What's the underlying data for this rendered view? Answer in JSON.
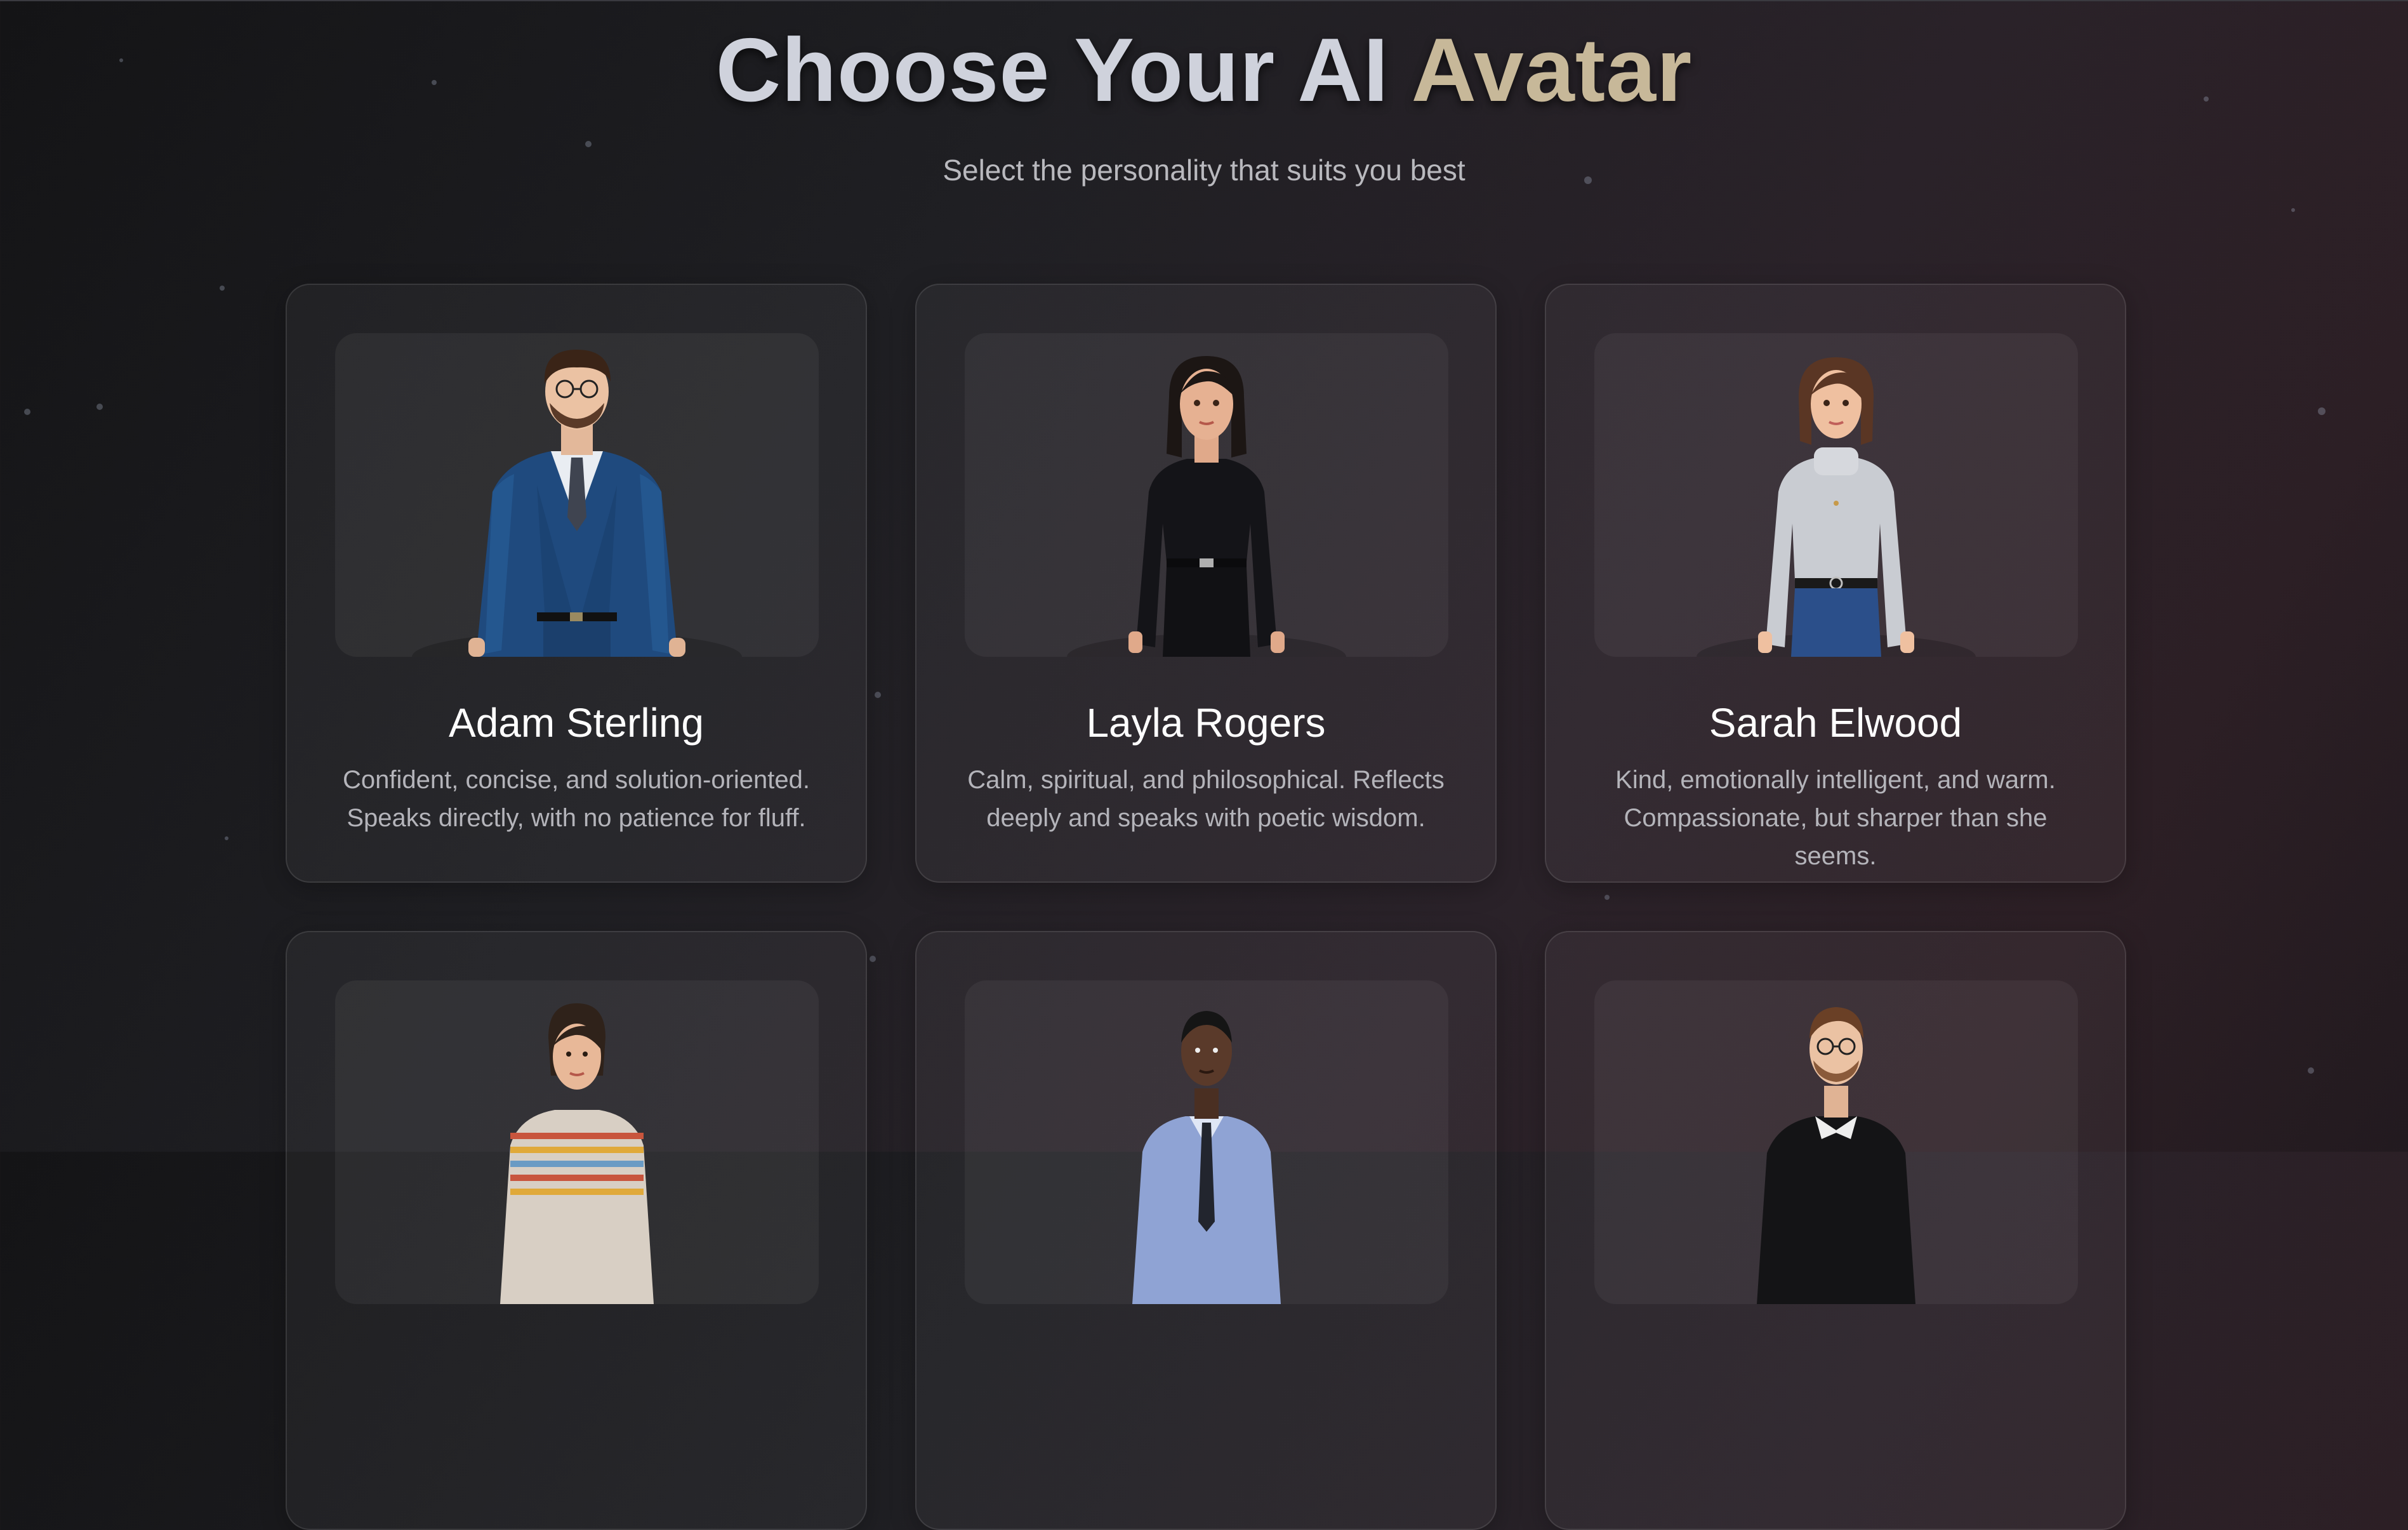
{
  "header": {
    "title_part1": "Choose Your AI",
    "title_part2": "Avatar",
    "subtitle": "Select the personality that suits you best"
  },
  "colors": {
    "title_main": "#cfd2dc",
    "title_accent": "#c7b899",
    "card_border": "rgba(255,255,255,0.10)"
  },
  "avatars": [
    {
      "name": "Adam Sterling",
      "description": "Confident, concise, and solution-oriented. Speaks directly, with no patience for fluff.",
      "image": "avatar-man-blue-suit"
    },
    {
      "name": "Layla Rogers",
      "description": "Calm, spiritual, and philosophical. Reflects deeply and speaks with poetic wisdom.",
      "image": "avatar-woman-black-shirt"
    },
    {
      "name": "Sarah Elwood",
      "description": "Kind, emotionally intelligent, and warm. Compassionate, but sharper than she seems.",
      "image": "avatar-woman-white-sweater"
    },
    {
      "name": "",
      "description": "",
      "image": "avatar-woman-striped-sweater"
    },
    {
      "name": "",
      "description": "",
      "image": "avatar-man-light-blue-shirt"
    },
    {
      "name": "",
      "description": "",
      "image": "avatar-man-dark-sweater"
    }
  ]
}
